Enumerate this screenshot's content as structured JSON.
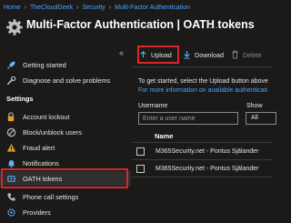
{
  "breadcrumb": [
    "Home",
    "TheCloudGeek",
    "Security",
    "Multi-Factor Authentication"
  ],
  "header": {
    "title": "Multi-Factor Authentication | OATH tokens",
    "more": "…"
  },
  "sidebar": {
    "collapse": "«",
    "top_items": [
      {
        "label": "Getting started",
        "icon": "rocket-icon"
      },
      {
        "label": "Diagnose and solve problems",
        "icon": "wrench-icon"
      }
    ],
    "settings_heading": "Settings",
    "items": [
      {
        "label": "Account lockout",
        "icon": "lock-icon"
      },
      {
        "label": "Block/unblock users",
        "icon": "block-icon"
      },
      {
        "label": "Fraud alert",
        "icon": "alert-icon"
      },
      {
        "label": "Notifications",
        "icon": "bell-icon"
      },
      {
        "label": "OATH tokens",
        "icon": "token-icon",
        "selected": true
      },
      {
        "label": "Phone call settings",
        "icon": "phone-icon"
      },
      {
        "label": "Providers",
        "icon": "gear-icon"
      }
    ]
  },
  "toolbar": {
    "upload": "Upload",
    "download": "Download",
    "delete": "Delete"
  },
  "info": {
    "line1": "To get started, select the Upload button above",
    "line2": "For more information on available authenticati"
  },
  "filters": {
    "username_label": "Username",
    "username_placeholder": "Enter a user name",
    "show_label": "Show",
    "show_value": "All"
  },
  "table": {
    "column": "Name",
    "rows": [
      "M365Security.net - Pontus Själander",
      "M365Security.net - Pontus Själander"
    ]
  },
  "colors": {
    "accent": "#4aa3ff",
    "highlight": "#d9262b",
    "background": "#1b1a19"
  }
}
